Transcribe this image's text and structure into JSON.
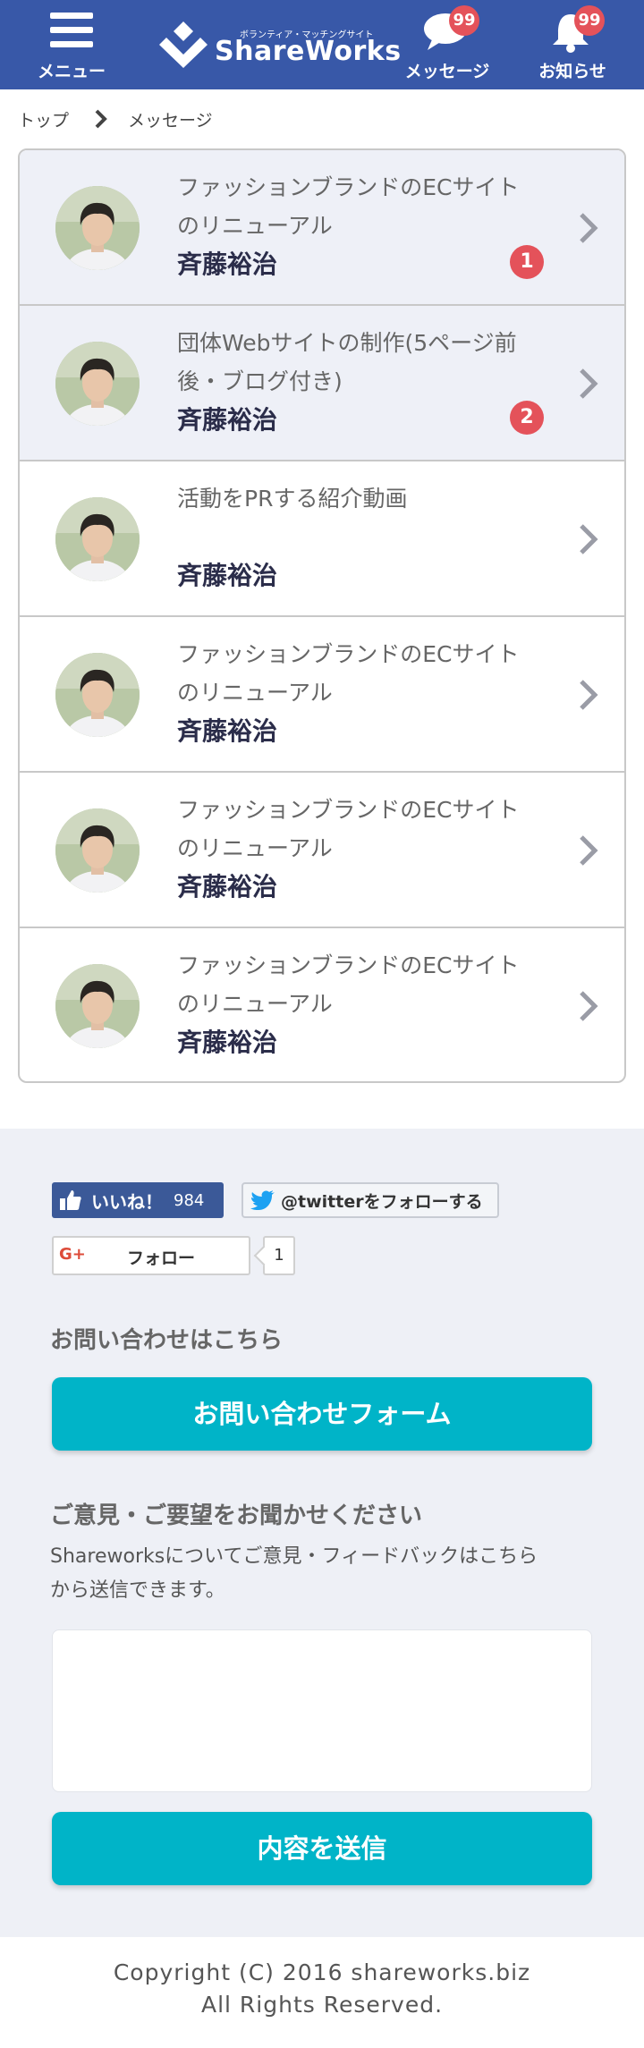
{
  "header": {
    "menu_label": "メニュー",
    "logo_sub": "ボランティア・マッチングサイト",
    "logo_text": "ShareWorks",
    "messages_label": "メッセージ",
    "messages_badge": "99",
    "notices_label": "お知らせ",
    "notices_badge": "99",
    "brand_color": "#3858a8",
    "badge_color": "#e4525a"
  },
  "breadcrumb": {
    "home": "トップ",
    "current": "メッセージ"
  },
  "messages": [
    {
      "title_line1": "ファッションブランドのECサイト",
      "title_line2": "のリニューアル",
      "sender": "斉藤裕治",
      "unread": "1"
    },
    {
      "title_line1": "団体Webサイトの制作(5ページ前",
      "title_line2": "後・ブログ付き)",
      "sender": "斉藤裕治",
      "unread": "2"
    },
    {
      "title_line1": "活動をPRする紹介動画",
      "title_line2": "",
      "sender": "斉藤裕治",
      "unread": ""
    },
    {
      "title_line1": "ファッションブランドのECサイト",
      "title_line2": "のリニューアル",
      "sender": "斉藤裕治",
      "unread": ""
    },
    {
      "title_line1": "ファッションブランドのECサイト",
      "title_line2": "のリニューアル",
      "sender": "斉藤裕治",
      "unread": ""
    },
    {
      "title_line1": "ファッションブランドのECサイト",
      "title_line2": "のリニューアル",
      "sender": "斉藤裕治",
      "unread": ""
    }
  ],
  "social": {
    "facebook_label": "いいね！",
    "facebook_count": "984",
    "twitter_label": "@twitterをフォローする",
    "gplus_icon": "G+",
    "gplus_label": "フォロー",
    "gplus_count": "1"
  },
  "contact": {
    "heading": "お問い合わせはこちら",
    "button": "お問い合わせフォーム"
  },
  "feedback": {
    "heading": "ご意見・ご要望をお聞かせください",
    "description_line1": "Shareworksについてご意見・フィードバックはこちら",
    "description_line2": "から送信できます。",
    "textarea_value": "",
    "submit": "内容を送信",
    "accent_color": "#00b4c8"
  },
  "footer": {
    "copyright_line1": "Copyright (C) 2016 shareworks.biz",
    "copyright_line2": "All Rights Reserved."
  }
}
